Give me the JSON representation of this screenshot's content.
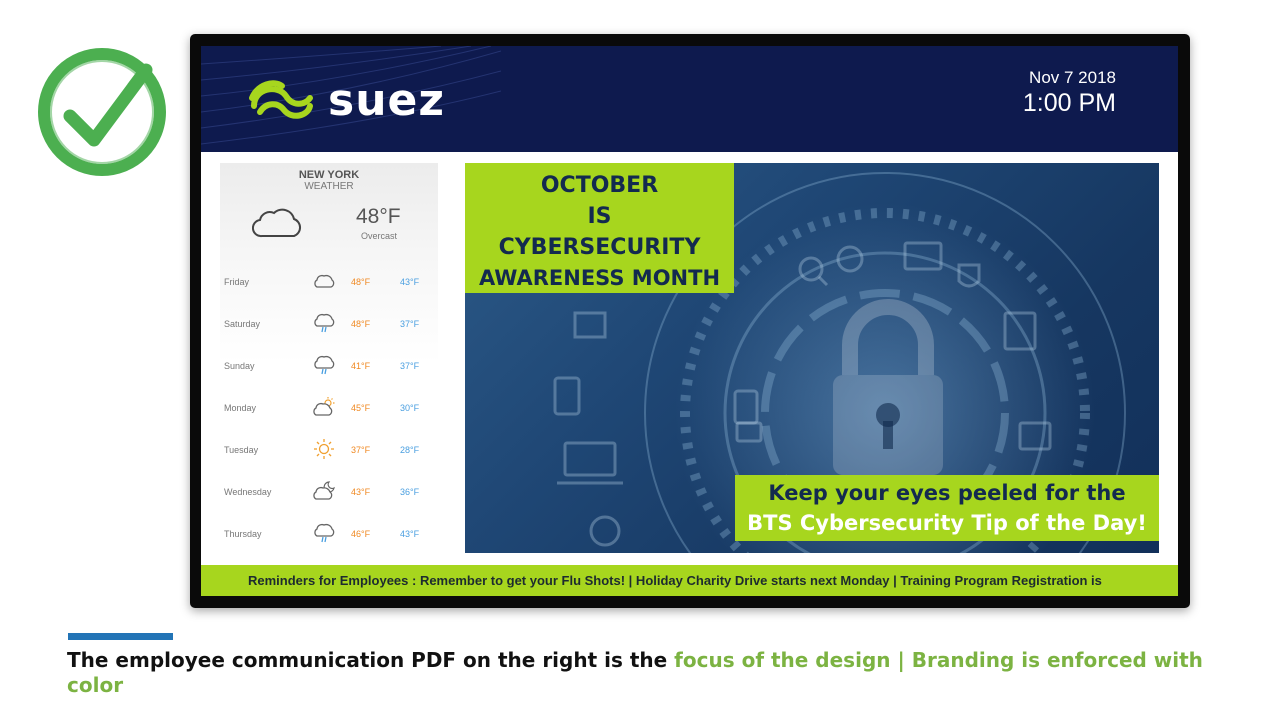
{
  "header": {
    "brand": "suez",
    "date": "Nov 7 2018",
    "time": "1:00 PM"
  },
  "weather": {
    "city": "NEW YORK",
    "label": "WEATHER",
    "current_temp": "48°F",
    "current_condition": "Overcast",
    "current_icon": "cloud-icon",
    "forecast": [
      {
        "day": "Friday",
        "icon": "cloud-icon",
        "high": "48°F",
        "low": "43°F"
      },
      {
        "day": "Saturday",
        "icon": "rain-cloud-icon",
        "high": "48°F",
        "low": "37°F"
      },
      {
        "day": "Sunday",
        "icon": "rain-cloud-icon",
        "high": "41°F",
        "low": "37°F"
      },
      {
        "day": "Monday",
        "icon": "partly-sunny-icon",
        "high": "45°F",
        "low": "30°F"
      },
      {
        "day": "Tuesday",
        "icon": "sun-icon",
        "high": "37°F",
        "low": "28°F"
      },
      {
        "day": "Wednesday",
        "icon": "cloud-moon-icon",
        "high": "43°F",
        "low": "36°F"
      },
      {
        "day": "Thursday",
        "icon": "rain-cloud-icon",
        "high": "46°F",
        "low": "43°F"
      }
    ]
  },
  "poster": {
    "title_lines": [
      "OCTOBER",
      "IS",
      "CYBERSECURITY",
      "AWARENESS MONTH"
    ],
    "tip_line1": "Keep your eyes peeled for the",
    "tip_line2": "BTS Cybersecurity Tip of the Day!"
  },
  "ticker": {
    "text": "Reminders for Employees : Remember to get your Flu Shots! | Holiday Charity Drive starts next Monday | Training Program Registration is"
  },
  "caption": {
    "part1": "The employee communication PDF on the right is the ",
    "part2": "focus of the design | Branding is enforced with color"
  },
  "colors": {
    "brand_navy": "#0e1a4e",
    "brand_green": "#a7d61e",
    "check_green": "#4caf50",
    "accent_blue": "#2274b6",
    "caption_highlight": "#7cb342",
    "high_temp": "#f08a24",
    "low_temp": "#4a9fe0"
  }
}
